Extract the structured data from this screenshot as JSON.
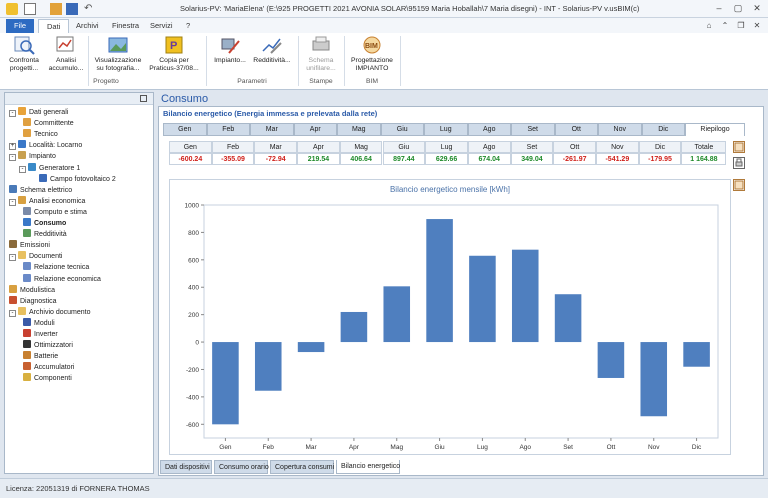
{
  "window": {
    "title": "Solarius-PV: 'MariaElena' (E:\\925 PROGETTI 2021 AVONIA SOLAR\\95159 Maria Hoballah\\7 Maria disegni) - INT - Solarius-PV v.usBIM(c)"
  },
  "ribbon_tabs": [
    {
      "label": "File"
    },
    {
      "label": "Dati"
    },
    {
      "label": "Archivi"
    },
    {
      "label": "Finestra"
    },
    {
      "label": "Servizi"
    },
    {
      "label": "?"
    }
  ],
  "ribbon": {
    "buttons": [
      {
        "label": "Confronta progetti...",
        "icon": "compare-icon"
      },
      {
        "label": "Analisi accumulo...",
        "icon": "analysis-icon"
      },
      {
        "label": "Visualizzazione su fotografia...",
        "icon": "photo-icon"
      },
      {
        "label": "Copia per Praticus-37/08...",
        "icon": "praticus-icon"
      },
      {
        "label": "Impianto...",
        "icon": "plant-icon"
      },
      {
        "label": "Redditività...",
        "icon": "profitability-icon"
      },
      {
        "label": "Schema unifilare...",
        "icon": "schema-icon"
      },
      {
        "label": "Progettazione IMPIANTO",
        "icon": "bim-icon"
      }
    ],
    "groups": [
      {
        "label": "Progetto"
      },
      {
        "label": "Parametri"
      },
      {
        "label": "Stampe"
      },
      {
        "label": "BIM"
      }
    ]
  },
  "tree": [
    {
      "label": "Dati generali",
      "level": 0,
      "expander": "-",
      "color": "#e8a33a"
    },
    {
      "label": "Committente",
      "level": 2,
      "color": "#e0a040"
    },
    {
      "label": "Tecnico",
      "level": 2,
      "color": "#e0a040"
    },
    {
      "label": "Località: Locarno",
      "level": 0,
      "expander": "+",
      "color": "#3a78c8"
    },
    {
      "label": "Impianto",
      "level": 0,
      "expander": "-",
      "color": "#c8a050"
    },
    {
      "label": "Generatore 1",
      "level": 1,
      "expander": "-",
      "color": "#3a8ac8"
    },
    {
      "label": "Campo fotovoltaico 2",
      "level": 3,
      "color": "#3a6ab8"
    },
    {
      "label": "Schema elettrico",
      "level": 0,
      "color": "#4a7ab8"
    },
    {
      "label": "Analisi economica",
      "level": 0,
      "expander": "-",
      "color": "#d8a040"
    },
    {
      "label": "Computo e stima",
      "level": 2,
      "color": "#7a8aa8"
    },
    {
      "label": "Consumo",
      "level": 2,
      "bold": true,
      "color": "#3a78c8"
    },
    {
      "label": "Redditività",
      "level": 2,
      "color": "#5a9a5a"
    },
    {
      "label": "Emissioni",
      "level": 0,
      "color": "#8a6a3a"
    },
    {
      "label": "Documenti",
      "level": 0,
      "expander": "-",
      "color": "#e8c060"
    },
    {
      "label": "Relazione tecnica",
      "level": 2,
      "color": "#6a8ac8"
    },
    {
      "label": "Relazione economica",
      "level": 2,
      "color": "#6a8ac8"
    },
    {
      "label": "Modulistica",
      "level": 0,
      "color": "#d8a040"
    },
    {
      "label": "Diagnostica",
      "level": 0,
      "color": "#c85030"
    },
    {
      "label": "Archivio documento",
      "level": 0,
      "expander": "-",
      "color": "#e8c060"
    },
    {
      "label": "Moduli",
      "level": 2,
      "color": "#3a5aa8"
    },
    {
      "label": "Inverter",
      "level": 2,
      "color": "#c84030"
    },
    {
      "label": "Ottimizzatori",
      "level": 2,
      "color": "#333333"
    },
    {
      "label": "Batterie",
      "level": 2,
      "color": "#c88030"
    },
    {
      "label": "Accumulatori",
      "level": 2,
      "color": "#c86030"
    },
    {
      "label": "Componenti",
      "level": 2,
      "color": "#d8b040"
    }
  ],
  "main": {
    "title": "Consumo",
    "section_title": "Bilancio energetico (Energia immessa e prelevata dalla rete)",
    "month_tabs": [
      "Gen",
      "Feb",
      "Mar",
      "Apr",
      "Mag",
      "Giu",
      "Lug",
      "Ago",
      "Set",
      "Ott",
      "Nov",
      "Dic",
      "Riepilogo"
    ],
    "table": {
      "headers": [
        "Gen",
        "Feb",
        "Mar",
        "Apr",
        "Mag",
        "Giu",
        "Lug",
        "Ago",
        "Set",
        "Ott",
        "Nov",
        "Dic",
        "Totale"
      ],
      "values": [
        "-600.24",
        "-355.09",
        "-72.94",
        "219.54",
        "406.64",
        "897.44",
        "629.66",
        "674.04",
        "349.04",
        "-261.97",
        "-541.29",
        "-179.95",
        "1 164.88"
      ]
    },
    "bottom_tabs": [
      "Dati dispositivi",
      "Consumo orario",
      "Copertura consumi",
      "Bilancio energetico"
    ]
  },
  "chart_data": {
    "type": "bar",
    "title": "Bilancio energetico mensile [kWh]",
    "categories": [
      "Gen",
      "Feb",
      "Mar",
      "Apr",
      "Mag",
      "Giu",
      "Lug",
      "Ago",
      "Set",
      "Ott",
      "Nov",
      "Dic"
    ],
    "values": [
      -600.24,
      -355.09,
      -72.94,
      219.54,
      406.64,
      897.44,
      629.66,
      674.04,
      349.04,
      -261.97,
      -541.29,
      -179.95
    ],
    "ylim": [
      -700,
      1000
    ],
    "yticks": [
      -600,
      -400,
      -200,
      0,
      200,
      400,
      600,
      800,
      1000
    ],
    "grid": false,
    "bar_color": "#4f7fbf"
  },
  "status": {
    "text": "Licenza: 22051319 di FORNERA THOMAS"
  },
  "colors": {
    "accent": "#2d6bc2",
    "negative": "#d0211b",
    "positive": "#1e8a2a"
  }
}
